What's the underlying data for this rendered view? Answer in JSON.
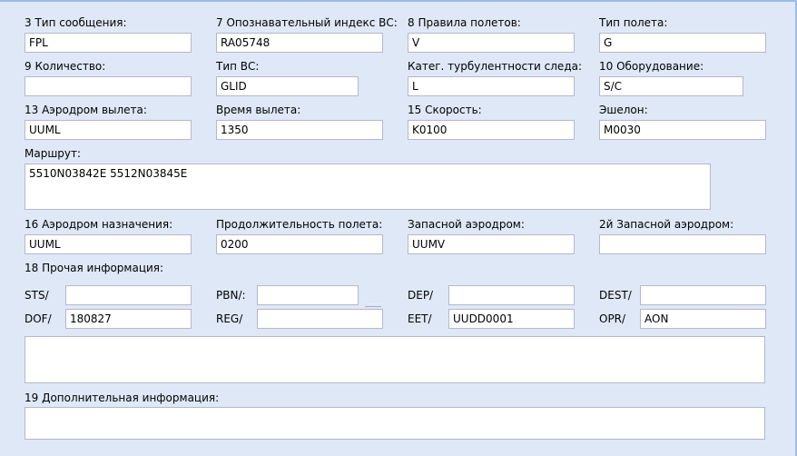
{
  "row1": {
    "msg_type": {
      "label": "3 Тип сообщения:",
      "value": "FPL"
    },
    "aircraft_id": {
      "label": "7 Опознавательный индекс ВС:",
      "value": "RA05748"
    },
    "flight_rules": {
      "label": "8 Правила полетов:",
      "value": "V"
    },
    "flight_type": {
      "label": "Тип полета:",
      "value": "G"
    }
  },
  "row2": {
    "quantity": {
      "label": "9 Количество:",
      "value": ""
    },
    "aircraft_type": {
      "label": "Тип ВС:",
      "value": "GLID"
    },
    "wake_category": {
      "label": "Катег. турбулентности следа:",
      "value": "L"
    },
    "equipment": {
      "label": "10 Оборудование:",
      "value": "S/C"
    }
  },
  "row3": {
    "dep_aerodrome": {
      "label": "13 Аэродром вылета:",
      "value": "UUML"
    },
    "dep_time": {
      "label": "Время вылета:",
      "value": "1350"
    },
    "speed": {
      "label": "15 Скорость:",
      "value": "K0100"
    },
    "level": {
      "label": "Эшелон:",
      "value": "M0030"
    }
  },
  "route": {
    "label": "Маршрут:",
    "value": "5510N03842E 5512N03845E"
  },
  "row4": {
    "dest_aerodrome": {
      "label": "16 Аэродром назначения:",
      "value": "UUML"
    },
    "duration": {
      "label": "Продолжительность полета:",
      "value": "0200"
    },
    "alt_aerodrome": {
      "label": "Запасной аэродром:",
      "value": "UUMV"
    },
    "alt2_aerodrome": {
      "label": "2й Запасной аэродром:",
      "value": ""
    }
  },
  "other_info": {
    "label": "18 Прочая информация:",
    "sts": {
      "label": "STS/",
      "value": ""
    },
    "pbn": {
      "label": "PBN/:",
      "value": ""
    },
    "dep": {
      "label": "DEP/",
      "value": ""
    },
    "dest": {
      "label": "DEST/",
      "value": ""
    },
    "dof": {
      "label": "DOF/",
      "value": "180827"
    },
    "reg": {
      "label": "REG/",
      "value": ""
    },
    "eet": {
      "label": "EET/",
      "value": "UUDD0001"
    },
    "opr": {
      "label": "OPR/",
      "value": "AON"
    },
    "free_text": ""
  },
  "supplementary": {
    "label": "19 Дополнительная информация:",
    "value": ""
  }
}
